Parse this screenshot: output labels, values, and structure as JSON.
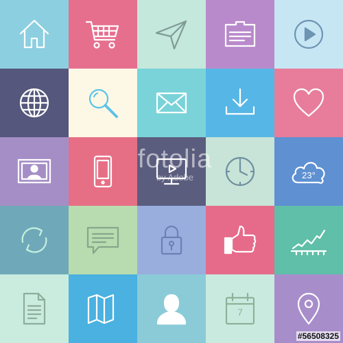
{
  "tiles": [
    {
      "icon": "home-icon",
      "bg": "#8ccfe0",
      "stroke": "#ffffff"
    },
    {
      "icon": "shopping-cart-icon",
      "bg": "#e66f8e",
      "stroke": "#ffffff"
    },
    {
      "icon": "paper-plane-icon",
      "bg": "#c4e8dc",
      "stroke": "#7f9a95"
    },
    {
      "icon": "id-card-icon",
      "bg": "#b98acb",
      "stroke": "#ffffff"
    },
    {
      "icon": "play-icon",
      "bg": "#c7e6f4",
      "stroke": "#6e94b3"
    },
    {
      "icon": "globe-icon",
      "bg": "#55577c",
      "stroke": "#ffffff"
    },
    {
      "icon": "search-icon",
      "bg": "#fdf8e6",
      "stroke": "#5cc3e6"
    },
    {
      "icon": "mail-icon",
      "bg": "#79d3d9",
      "stroke": "#ffffff"
    },
    {
      "icon": "download-icon",
      "bg": "#56b6e6",
      "stroke": "#ffffff"
    },
    {
      "icon": "heart-icon",
      "bg": "#e77d9b",
      "stroke": "#ffffff"
    },
    {
      "icon": "user-screen-icon",
      "bg": "#a58ec6",
      "stroke": "#ffffff"
    },
    {
      "icon": "smartphone-icon",
      "bg": "#e66f85",
      "stroke": "#ffffff"
    },
    {
      "icon": "monitor-icon",
      "bg": "#5b5d7e",
      "stroke": "#ffffff"
    },
    {
      "icon": "clock-icon",
      "bg": "#c8e3d8",
      "stroke": "#6e8f9e"
    },
    {
      "icon": "cloud-weather-icon",
      "bg": "#5e90d2",
      "stroke": "#ffffff"
    },
    {
      "icon": "refresh-icon",
      "bg": "#6fa9b9",
      "stroke": "#c6f0df"
    },
    {
      "icon": "chat-bubble-icon",
      "bg": "#b8dcaf",
      "stroke": "#85a68b"
    },
    {
      "icon": "lock-icon",
      "bg": "#9aaede",
      "stroke": "#6e7fb5"
    },
    {
      "icon": "thumbs-up-icon",
      "bg": "#e66b8a",
      "stroke": "#ffffff"
    },
    {
      "icon": "chart-icon",
      "bg": "#5fbfa8",
      "stroke": "#ffffff"
    },
    {
      "icon": "document-icon",
      "bg": "#c9ecdf",
      "stroke": "#8eac9a"
    },
    {
      "icon": "map-icon",
      "bg": "#4ab1e0",
      "stroke": "#ffffff"
    },
    {
      "icon": "user-icon",
      "bg": "#8bcbd8",
      "stroke": "#ffffff"
    },
    {
      "icon": "calendar-icon",
      "bg": "#c9ebdf",
      "stroke": "#8fb09a"
    },
    {
      "icon": "location-pin-icon",
      "bg": "#a88dcb",
      "stroke": "#ffffff"
    }
  ],
  "weather_temp": "23°",
  "calendar_day": "7",
  "watermark": {
    "main": "fotolia",
    "sub": "by Adobe"
  },
  "stock_id": "#56508325"
}
